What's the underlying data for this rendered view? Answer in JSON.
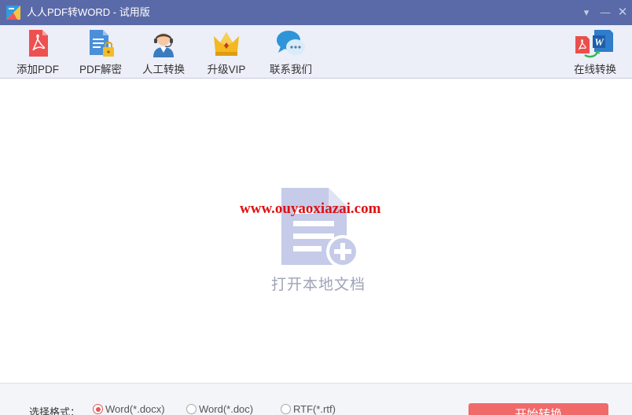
{
  "window": {
    "title": "人人PDF转WORD - 试用版",
    "controls": {
      "menu": "▾",
      "minimize": "—",
      "close": "✕"
    }
  },
  "toolbar": {
    "items": [
      {
        "label": "添加PDF",
        "icon": "add-pdf-icon"
      },
      {
        "label": "PDF解密",
        "icon": "pdf-decrypt-icon"
      },
      {
        "label": "人工转换",
        "icon": "customer-service-icon"
      },
      {
        "label": "升级VIP",
        "icon": "crown-icon"
      },
      {
        "label": "联系我们",
        "icon": "chat-bubble-icon"
      }
    ],
    "right_item": {
      "label": "在线转换",
      "icon": "pdf-to-word-icon"
    }
  },
  "main": {
    "open_label": "打开本地文档",
    "watermark": "www.ouyaoxiazai.com"
  },
  "bottom": {
    "format_label": "选择格式：",
    "formats": [
      {
        "label": "Word(*.docx)",
        "selected": true
      },
      {
        "label": "Word(*.doc)",
        "selected": false
      },
      {
        "label": "RTF(*.rtf)",
        "selected": false
      }
    ],
    "convert_label": "开始转换"
  },
  "colors": {
    "titlebar": "#5a6aa8",
    "toolbar": "#eceef8",
    "accent": "#f06a6a",
    "placeholder": "#c5cbe8"
  }
}
